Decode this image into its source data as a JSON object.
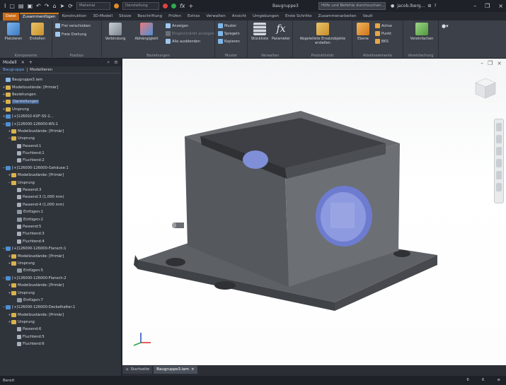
{
  "window": {
    "document_title": "Baugruppe3",
    "help_search": "Hilfe und Befehle durchsuchen...",
    "user": "jacob.lberg...",
    "quick_access": {
      "material_combo": "Material",
      "appearance_combo": "Darstellung"
    }
  },
  "ribbon_tabs": [
    {
      "label": "Datei"
    },
    {
      "label": "Zusammenfügen"
    },
    {
      "label": "Konstruktion"
    },
    {
      "label": "3D-Modell"
    },
    {
      "label": "Skizze"
    },
    {
      "label": "Beschriftung"
    },
    {
      "label": "Prüfen"
    },
    {
      "label": "Extras"
    },
    {
      "label": "Verwalten"
    },
    {
      "label": "Ansicht"
    },
    {
      "label": "Umgebungen"
    },
    {
      "label": "Erste Schritte"
    },
    {
      "label": "Zusammenarbeiten"
    },
    {
      "label": "Vault"
    }
  ],
  "ribbon": {
    "komponente": {
      "label": "Komponente",
      "platzieren": "Platzieren",
      "erstellen": "Erstellen",
      "muster": "Muster",
      "kopieren": "Kopieren",
      "spiegeln": "Spiegeln"
    },
    "position": {
      "label": "Position",
      "frei_verschieben": "Frei verschieben",
      "freie_drehung": "Freie Drehung"
    },
    "beziehungen": {
      "label": "Beziehungen",
      "verbindung": "Verbindung",
      "abhaengigkeit": "Abhängigkeit",
      "anzeigen": "Anzeigen",
      "eingeschraenkt": "Eingeschränkt anzeigen",
      "alle_ausblenden": "Alle ausblenden"
    },
    "muster": {
      "label": "Muster",
      "muster": "Muster",
      "spiegeln": "Spiegeln",
      "kopieren": "Kopieren"
    },
    "verwalten": {
      "label": "Verwalten",
      "stueckliste": "Stückliste",
      "parameter": "Parameter"
    },
    "produktivitaet": {
      "label": "Produktivität",
      "abgeleitete": "Abgeleitete Ersatzobjekte erstellen"
    },
    "arbeitselemente": {
      "label": "Arbeitselemente",
      "ebene": "Ebene",
      "achse": "Achse",
      "punkt": "Punkt",
      "bks": "BKS"
    },
    "vereinfachung": {
      "label": "Vereinfachung",
      "vereinfachen": "Vereinfachen"
    }
  },
  "browser": {
    "title": "Modell",
    "subtab_1": "Baugruppe",
    "subtab_2": "Modellieren",
    "items": [
      {
        "label": "Baugruppe3.iam",
        "level": 0,
        "icon": "asm",
        "twisty": ""
      },
      {
        "label": "Modellzustände: [Primär]",
        "level": 0,
        "icon": "folder",
        "twisty": "+"
      },
      {
        "label": "Beziehungen",
        "level": 0,
        "icon": "folder",
        "twisty": "+"
      },
      {
        "label": "Darstellungen",
        "level": 0,
        "icon": "folder",
        "twisty": "+"
      },
      {
        "label": "Ursprung",
        "level": 0,
        "icon": "folder",
        "twisty": "+"
      },
      {
        "label": "[+]126002-KXF-S5-2...",
        "level": 0,
        "icon": "part",
        "twisty": "+"
      },
      {
        "label": "[+]126000-126000-WS:1",
        "level": 0,
        "icon": "part",
        "twisty": "−"
      },
      {
        "label": "Modellzustände: [Primär]",
        "level": 1,
        "icon": "folder",
        "twisty": "+"
      },
      {
        "label": "Ursprung",
        "level": 1,
        "icon": "folder",
        "twisty": "−"
      },
      {
        "label": "Passend:1",
        "level": 2,
        "icon": "sketch",
        "twisty": ""
      },
      {
        "label": "Fluchtend:1",
        "level": 2,
        "icon": "sketch",
        "twisty": ""
      },
      {
        "label": "Fluchtend:2",
        "level": 2,
        "icon": "sketch",
        "twisty": ""
      },
      {
        "label": "[+]126000-126000-Gehäuse:1",
        "level": 0,
        "icon": "part",
        "twisty": "−"
      },
      {
        "label": "Modellzustände: [Primär]",
        "level": 1,
        "icon": "folder",
        "twisty": "+"
      },
      {
        "label": "Ursprung",
        "level": 1,
        "icon": "folder",
        "twisty": "−"
      },
      {
        "label": "Passend:3",
        "level": 2,
        "icon": "sketch",
        "twisty": ""
      },
      {
        "label": "Passend:3 (1,000 mm)",
        "level": 2,
        "icon": "sketch",
        "twisty": ""
      },
      {
        "label": "Passend:4 (1,000 mm)",
        "level": 2,
        "icon": "sketch",
        "twisty": ""
      },
      {
        "label": "Einfügen:1",
        "level": 2,
        "icon": "feature",
        "twisty": ""
      },
      {
        "label": "Einfügen:2",
        "level": 2,
        "icon": "feature",
        "twisty": ""
      },
      {
        "label": "Passend:5",
        "level": 2,
        "icon": "sketch",
        "twisty": ""
      },
      {
        "label": "Fluchtend:3",
        "level": 2,
        "icon": "sketch",
        "twisty": ""
      },
      {
        "label": "Fluchtend:4",
        "level": 2,
        "icon": "sketch",
        "twisty": ""
      },
      {
        "label": "[+]126000-126000-Flansch:1",
        "level": 0,
        "icon": "part",
        "twisty": "−"
      },
      {
        "label": "Modellzustände: [Primär]",
        "level": 1,
        "icon": "folder",
        "twisty": "+"
      },
      {
        "label": "Ursprung",
        "level": 1,
        "icon": "folder",
        "twisty": "+"
      },
      {
        "label": "Einfügen:5",
        "level": 2,
        "icon": "feature",
        "twisty": ""
      },
      {
        "label": "[+]126000-126000-Flansch:2",
        "level": 0,
        "icon": "part",
        "twisty": "−"
      },
      {
        "label": "Modellzustände: [Primär]",
        "level": 1,
        "icon": "folder",
        "twisty": "+"
      },
      {
        "label": "Ursprung",
        "level": 1,
        "icon": "folder",
        "twisty": "+"
      },
      {
        "label": "Einfügen:7",
        "level": 2,
        "icon": "feature",
        "twisty": ""
      },
      {
        "label": "[+]126000-126000-Deckelhalter:1",
        "level": 0,
        "icon": "part",
        "twisty": "−"
      },
      {
        "label": "Modellzustände: [Primär]",
        "level": 1,
        "icon": "folder",
        "twisty": "+"
      },
      {
        "label": "Ursprung",
        "level": 1,
        "icon": "folder",
        "twisty": "+"
      },
      {
        "label": "Passend:6",
        "level": 2,
        "icon": "sketch",
        "twisty": ""
      },
      {
        "label": "Fluchtend:5",
        "level": 2,
        "icon": "sketch",
        "twisty": ""
      },
      {
        "label": "Fluchtend:6",
        "level": 2,
        "icon": "sketch",
        "twisty": ""
      }
    ]
  },
  "doc_tabs": [
    {
      "label": "Startseite",
      "active": false
    },
    {
      "label": "Baugruppe3.iam",
      "active": true
    }
  ],
  "status": {
    "text": "Bereit",
    "count_1": "6",
    "count_2": "6"
  },
  "colors": {
    "accent": "#c96a16",
    "link": "#6fb1ff",
    "model_body": "#5b5e63",
    "glass": "#7f8fd8"
  }
}
